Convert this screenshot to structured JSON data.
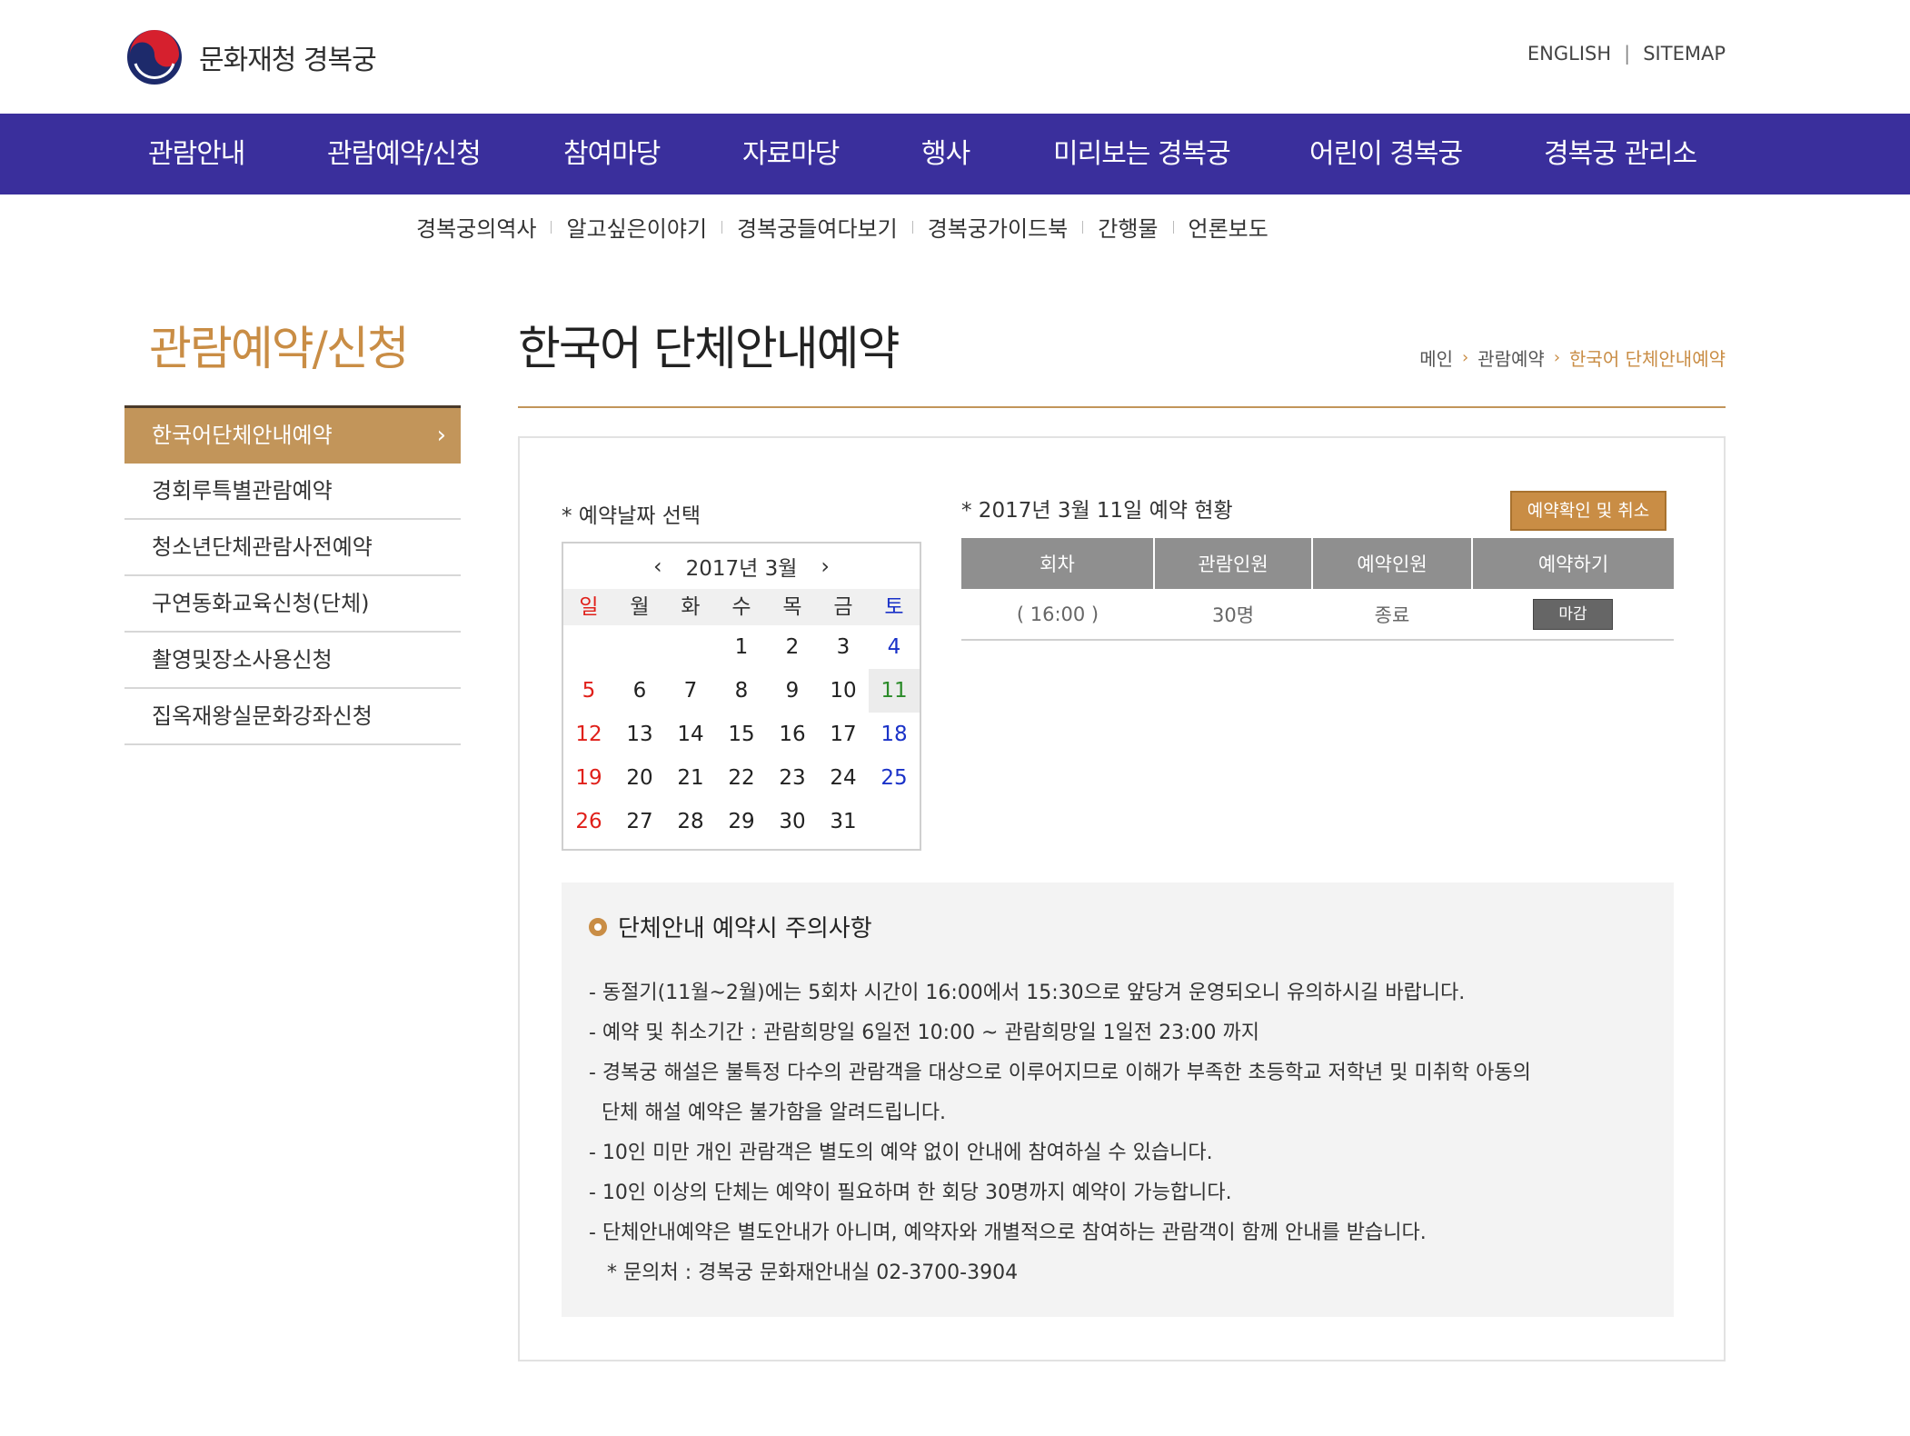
{
  "header": {
    "logo_text": "문화재청 경복궁",
    "util_links": [
      "ENGLISH",
      "SITEMAP"
    ]
  },
  "gnb": [
    "관람안내",
    "관람예약/신청",
    "참여마당",
    "자료마당",
    "행사",
    "미리보는 경복궁",
    "어린이 경복궁",
    "경복궁 관리소"
  ],
  "submenu": [
    "경복궁의역사",
    "알고싶은이야기",
    "경복궁들여다보기",
    "경복궁가이드북",
    "간행물",
    "언론보도"
  ],
  "lnb": {
    "title": "관람예약/신청",
    "items": [
      "한국어단체안내예약",
      "경회루특별관람예약",
      "청소년단체관람사전예약",
      "구연동화교육신청(단체)",
      "촬영및장소사용신청",
      "집옥재왕실문화강좌신청"
    ],
    "active_chevron": "›"
  },
  "page": {
    "title": "한국어 단체안내예약",
    "breadcrumb": [
      "메인",
      "관람예약",
      "한국어 단체안내예약"
    ]
  },
  "calendar": {
    "label": "* 예약날짜 선택",
    "month_label": "2017년 3월",
    "prev": "‹",
    "next": "›",
    "weekdays": [
      "일",
      "월",
      "화",
      "수",
      "목",
      "금",
      "토"
    ],
    "weeks": [
      [
        "",
        "",
        "",
        "1",
        "2",
        "3",
        "4"
      ],
      [
        "5",
        "6",
        "7",
        "8",
        "9",
        "10",
        "11"
      ],
      [
        "12",
        "13",
        "14",
        "15",
        "16",
        "17",
        "18"
      ],
      [
        "19",
        "20",
        "21",
        "22",
        "23",
        "24",
        "25"
      ],
      [
        "26",
        "27",
        "28",
        "29",
        "30",
        "31",
        ""
      ]
    ],
    "selected_day": "11"
  },
  "reservation": {
    "status_label": "* 2017년 3월 11일 예약 현황",
    "confirm_button": "예약확인 및 취소",
    "columns": [
      "회차",
      "관람인원",
      "예약인원",
      "예약하기"
    ],
    "rows": [
      {
        "session": "( 16:00 )",
        "capacity": "30명",
        "reserved": "종료",
        "action": "마감"
      }
    ]
  },
  "notice": {
    "title": "단체안내 예약시 주의사항",
    "lines": [
      "- 동절기(11월~2월)에는 5회차 시간이 16:00에서 15:30으로 앞당겨 운영되오니 유의하시길 바랍니다.",
      "- 예약 및 취소기간 : 관람희망일 6일전 10:00 ~ 관람희망일 1일전 23:00 까지",
      "- 경복궁 해설은 불특정 다수의 관람객을 대상으로 이루어지므로 이해가 부족한 초등학교 저학년 및 미취학 아동의",
      "단체 해설 예약은 불가함을 알려드립니다.",
      "- 10인 미만 개인 관람객은 별도의 예약 없이 안내에 참여하실 수 있습니다.",
      "- 10인 이상의 단체는 예약이 필요하며 한 회당 30명까지 예약이 가능합니다.",
      "- 단체안내예약은 별도안내가 아니며, 예약자와 개별적으로 참여하는 관람객이 함께 안내를 받습니다.",
      "* 문의처 : 경복궁 문화재안내실 02-3700-3904"
    ]
  },
  "colors": {
    "gnb_bg": "#3a2f9c",
    "accent": "#c98d45",
    "sunday": "#e0201a",
    "saturday": "#1a32c8",
    "selected_day": "#2a8a28"
  }
}
